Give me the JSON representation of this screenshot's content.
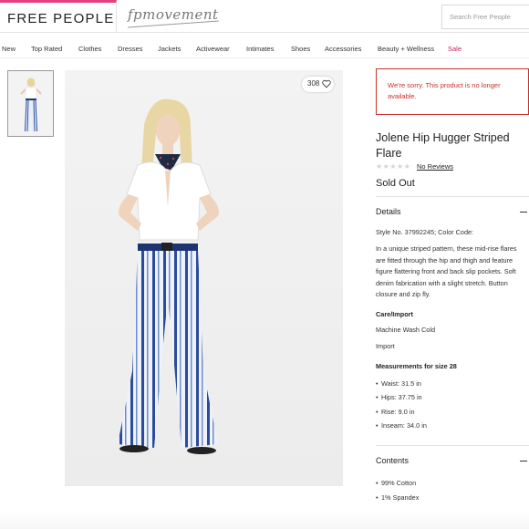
{
  "header": {
    "brand": "FREE PEOPLE",
    "sub_brand": "fpmovement",
    "search_placeholder": "Search Free People"
  },
  "nav": {
    "items": [
      "New",
      "Top Rated",
      "Clothes",
      "Dresses",
      "Jackets",
      "Activewear",
      "Intimates",
      "Shoes",
      "Accessories",
      "Beauty + Wellness",
      "Sale"
    ]
  },
  "gallery": {
    "favorites_count": "308",
    "product_image": "model wearing white top and blue striped flare jeans"
  },
  "product": {
    "alert": "We're sorry. This product is no longer available.",
    "title": "Jolene Hip Hugger Striped Flare",
    "stars": "★★★★★",
    "reviews_link": "No Reviews",
    "availability": "Sold Out"
  },
  "details": {
    "heading": "Details",
    "style_line": "Style No. 37992245; Color Code:",
    "description": "In a unique striped pattern, these mid-rise flares are fitted through the hip and thigh and feature figure flattering front and back slip pockets. Soft denim fabrication with a slight stretch. Button closure and zip fly.",
    "care_heading": "Care/Import",
    "care_items": [
      "Machine Wash Cold",
      "Import"
    ],
    "measurements_heading": "Measurements for size 28",
    "measurements": [
      "Waist: 31.5 in",
      "Hips: 37.75 in",
      "Rise: 9.0 in",
      "Inseam: 34.0 in"
    ]
  },
  "contents": {
    "heading": "Contents",
    "items": [
      "99% Cotton",
      "1% Spandex"
    ]
  },
  "colors": {
    "accent_pink": "#e3407d",
    "sale_red": "#c81e5b",
    "alert_red": "#c9302c"
  }
}
